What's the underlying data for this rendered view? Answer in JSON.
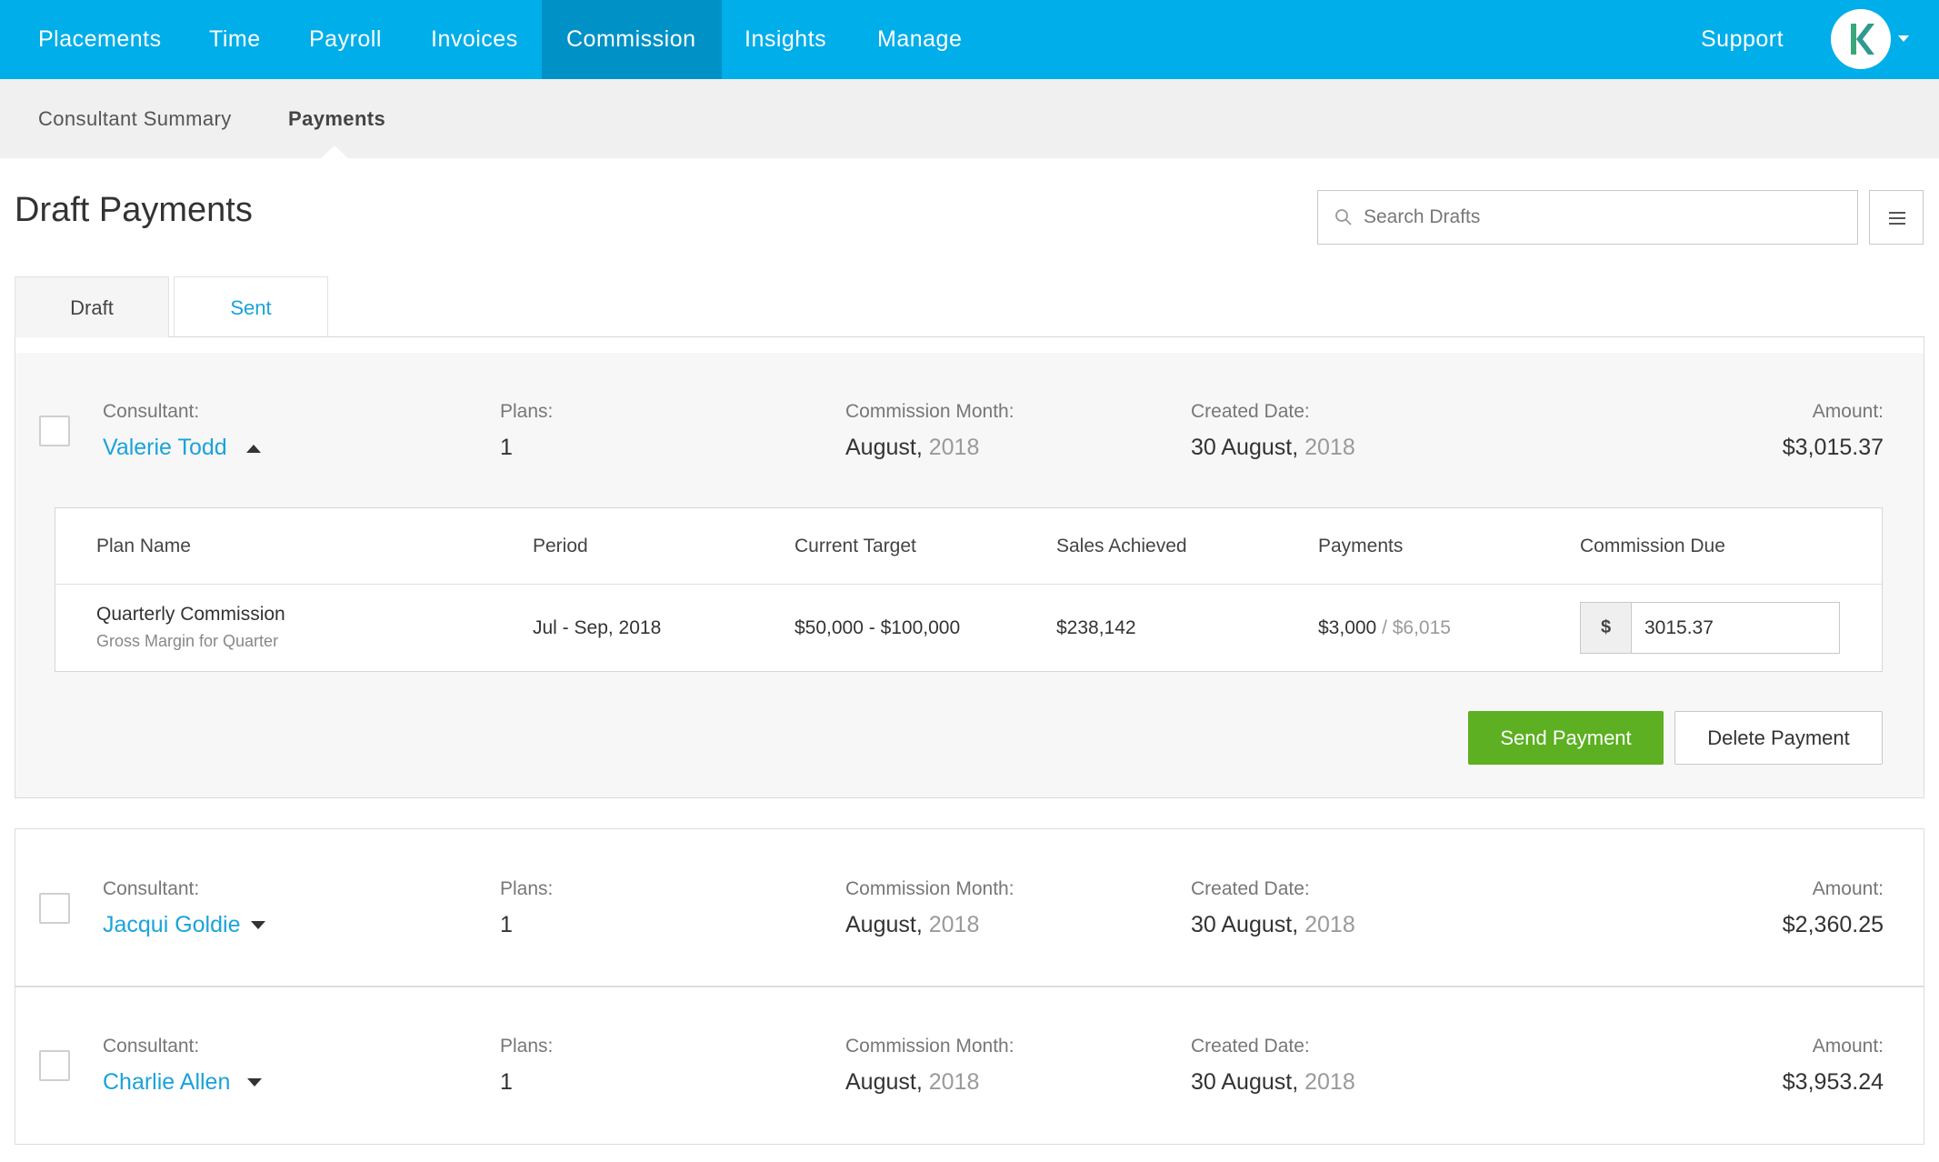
{
  "topnav": {
    "items": [
      {
        "label": "Placements"
      },
      {
        "label": "Time"
      },
      {
        "label": "Payroll"
      },
      {
        "label": "Invoices"
      },
      {
        "label": "Commission",
        "active": true
      },
      {
        "label": "Insights"
      },
      {
        "label": "Manage"
      }
    ],
    "support_label": "Support",
    "avatar_letter": "K"
  },
  "subnav": {
    "items": [
      {
        "label": "Consultant Summary"
      },
      {
        "label": "Payments",
        "active": true
      }
    ]
  },
  "page": {
    "title": "Draft Payments",
    "search_placeholder": "Search Drafts"
  },
  "tabs": [
    {
      "label": "Draft",
      "active": true
    },
    {
      "label": "Sent"
    }
  ],
  "labels": {
    "consultant": "Consultant:",
    "plans": "Plans:",
    "commission_month": "Commission Month:",
    "created_date": "Created Date:",
    "amount": "Amount:"
  },
  "payments": [
    {
      "consultant": "Valerie Todd",
      "expanded": true,
      "plans": "1",
      "commission_month": "August,",
      "commission_year": " 2018",
      "created_date": "30 August,",
      "created_year": " 2018",
      "amount": "$3,015.37",
      "plan_table": {
        "headers": [
          "Plan Name",
          "Period",
          "Current Target",
          "Sales Achieved",
          "Payments",
          "Commission Due"
        ],
        "rows": [
          {
            "plan_name": "Quarterly Commission",
            "plan_sub": "Gross Margin for Quarter",
            "period": "Jul - Sep, 2018",
            "current_target": "$50,000 - $100,000",
            "sales_achieved": "$238,142",
            "payments": "$3,000",
            "payments_total": " / $6,015",
            "currency_symbol": "$",
            "commission_due": "3015.37"
          }
        ]
      },
      "actions": {
        "send": "Send Payment",
        "delete": "Delete Payment"
      }
    },
    {
      "consultant": "Jacqui Goldie",
      "expanded": false,
      "plans": "1",
      "commission_month": "August,",
      "commission_year": " 2018",
      "created_date": "30 August,",
      "created_year": " 2018",
      "amount": "$2,360.25"
    },
    {
      "consultant": "Charlie Allen",
      "expanded": false,
      "plans": "1",
      "commission_month": "August,",
      "commission_year": " 2018",
      "created_date": "30 August,",
      "created_year": " 2018",
      "amount": "$3,953.24"
    }
  ],
  "colors": {
    "brand": "#00aee9",
    "brand_active": "#0092c6",
    "link": "#1aa3d9",
    "success": "#5cb021",
    "avatar_logo": "#3aa77a"
  }
}
